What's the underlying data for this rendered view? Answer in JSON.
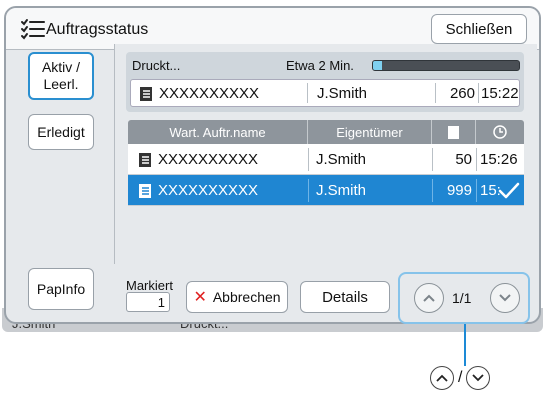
{
  "dialog": {
    "title": "Auftragsstatus",
    "close_label": "Schließen"
  },
  "sidebar": {
    "active_label_line1": "Aktiv /",
    "active_label_line2": "Leerl.",
    "done_label": "Erledigt",
    "paper_info_label": "PapInfo"
  },
  "printing": {
    "status": "Druckt...",
    "eta": "Etwa 2 Min.",
    "progress": 0.06,
    "job": {
      "name": "XXXXXXXXXX",
      "owner": "J.Smith",
      "copies": "260",
      "time": "15:22"
    }
  },
  "table": {
    "headers": {
      "name": "Wart. Auftr.name",
      "owner": "Eigentümer"
    },
    "rows": [
      {
        "name": "XXXXXXXXXX",
        "owner": "J.Smith",
        "copies": "50",
        "time": "15:26",
        "selected": false
      },
      {
        "name": "XXXXXXXXXX",
        "owner": "J.Smith",
        "copies": "999",
        "time": "15:",
        "selected": true
      }
    ]
  },
  "footer": {
    "marked_label": "Markiert",
    "marked_count": "1",
    "cancel_label": "Abbrechen",
    "details_label": "Details",
    "page_indicator": "1/1"
  },
  "background": {
    "user": "J.Smith",
    "job_status": "Druckt..."
  },
  "callout": {
    "separator": "/"
  },
  "colors": {
    "accent": "#1f86d2",
    "highlight": "#86c3ea",
    "cancel": "#e02020"
  }
}
